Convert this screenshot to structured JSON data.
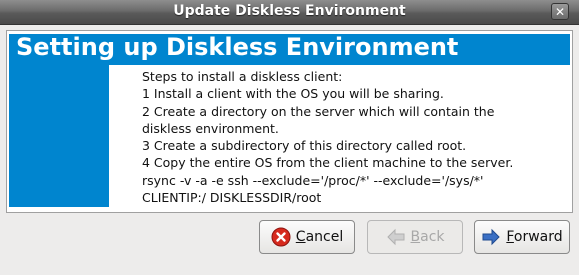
{
  "window": {
    "title": "Update Diskless Environment",
    "close_symbol": "✕"
  },
  "banner": {
    "heading": "Setting up Diskless Environment"
  },
  "steps": [
    "Steps to install a diskless client:",
    "1 Install a client with the OS you will be sharing.",
    "2 Create a directory on the server which will contain the",
    "diskless environment.",
    "3 Create a subdirectory of this directory called root.",
    "4 Copy the entire OS from the client machine to the server.",
    "rsync -v -a -e ssh --exclude='/proc/*' --exclude='/sys/*'",
    "CLIENTIP:/ DISKLESSDIR/root"
  ],
  "buttons": {
    "cancel": {
      "mnemonic": "C",
      "rest": "ancel"
    },
    "back": {
      "mnemonic": "B",
      "rest": "ack"
    },
    "forward": {
      "mnemonic": "F",
      "rest": "orward"
    }
  },
  "colors": {
    "accent": "#0085cf",
    "cancel_icon": "#d62a1e",
    "forward_icon": "#3a6fc4"
  }
}
